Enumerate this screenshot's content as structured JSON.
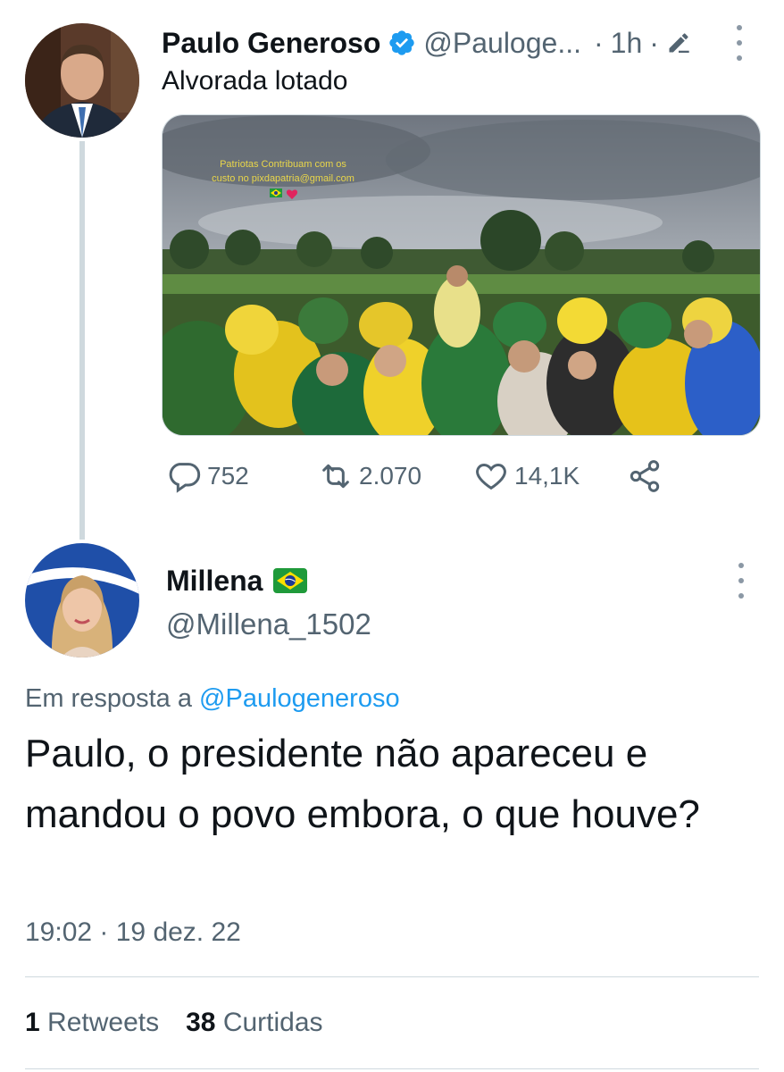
{
  "parent_tweet": {
    "author_name": "Paulo Generoso",
    "verified_icon": "verified-badge-icon",
    "handle": "@Pauloge...",
    "separator": "·",
    "time": "1h",
    "separator2": "·",
    "edit_icon": "edit-pencil-icon",
    "text": "Alvorada lotado",
    "media": {
      "overlay_line1": "Patriotas Contribuam com os",
      "overlay_line2": "custo no pixdapatria@gmail.com"
    },
    "actions": {
      "replies": "752",
      "retweets": "2.070",
      "likes": "14,1K"
    }
  },
  "reply_tweet": {
    "author_name": "Millena",
    "flag_icon": "brazil-flag-icon",
    "handle": "@Millena_1502",
    "reply_prefix": "Em resposta a",
    "reply_to_handle": "@Paulogeneroso",
    "text": "Paulo, o presidente não apareceu e mandou o povo embora, o que houve?",
    "timestamp": "19:02 · 19 dez. 22",
    "stats": {
      "retweets_count": "1",
      "retweets_label": "Retweets",
      "likes_count": "38",
      "likes_label": "Curtidas"
    }
  },
  "colors": {
    "accent": "#1d9bf0",
    "text": "#0f1419",
    "muted": "#536471",
    "border": "#cfd9de"
  }
}
